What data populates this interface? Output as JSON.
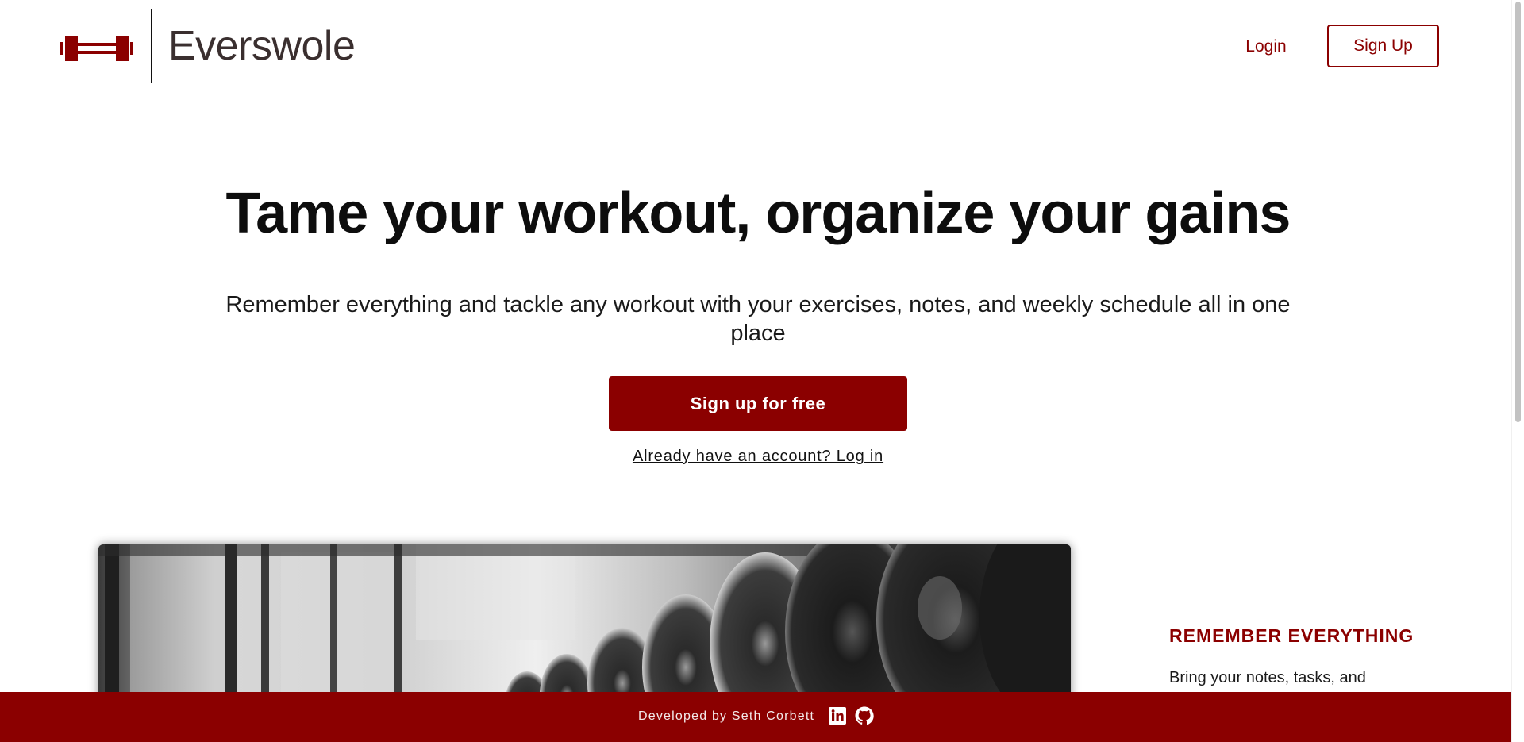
{
  "header": {
    "brand": "Everswole",
    "nav": {
      "login_label": "Login",
      "signup_label": "Sign Up"
    }
  },
  "hero": {
    "title": "Tame your workout, organize your gains",
    "subtitle": "Remember everything and tackle any workout with your exercises, notes, and weekly schedule all in one place",
    "cta_label": "Sign up for free",
    "login_link": "Already have an account? Log in"
  },
  "feature": {
    "heading": "REMEMBER EVERYTHING",
    "body": "Bring your notes, tasks, and"
  },
  "footer": {
    "credit": "Developed by Seth Corbett",
    "icons": [
      "linkedin-icon",
      "github-icon"
    ]
  },
  "colors": {
    "brand": "#8b0000",
    "text": "#111111",
    "background": "#ffffff"
  }
}
